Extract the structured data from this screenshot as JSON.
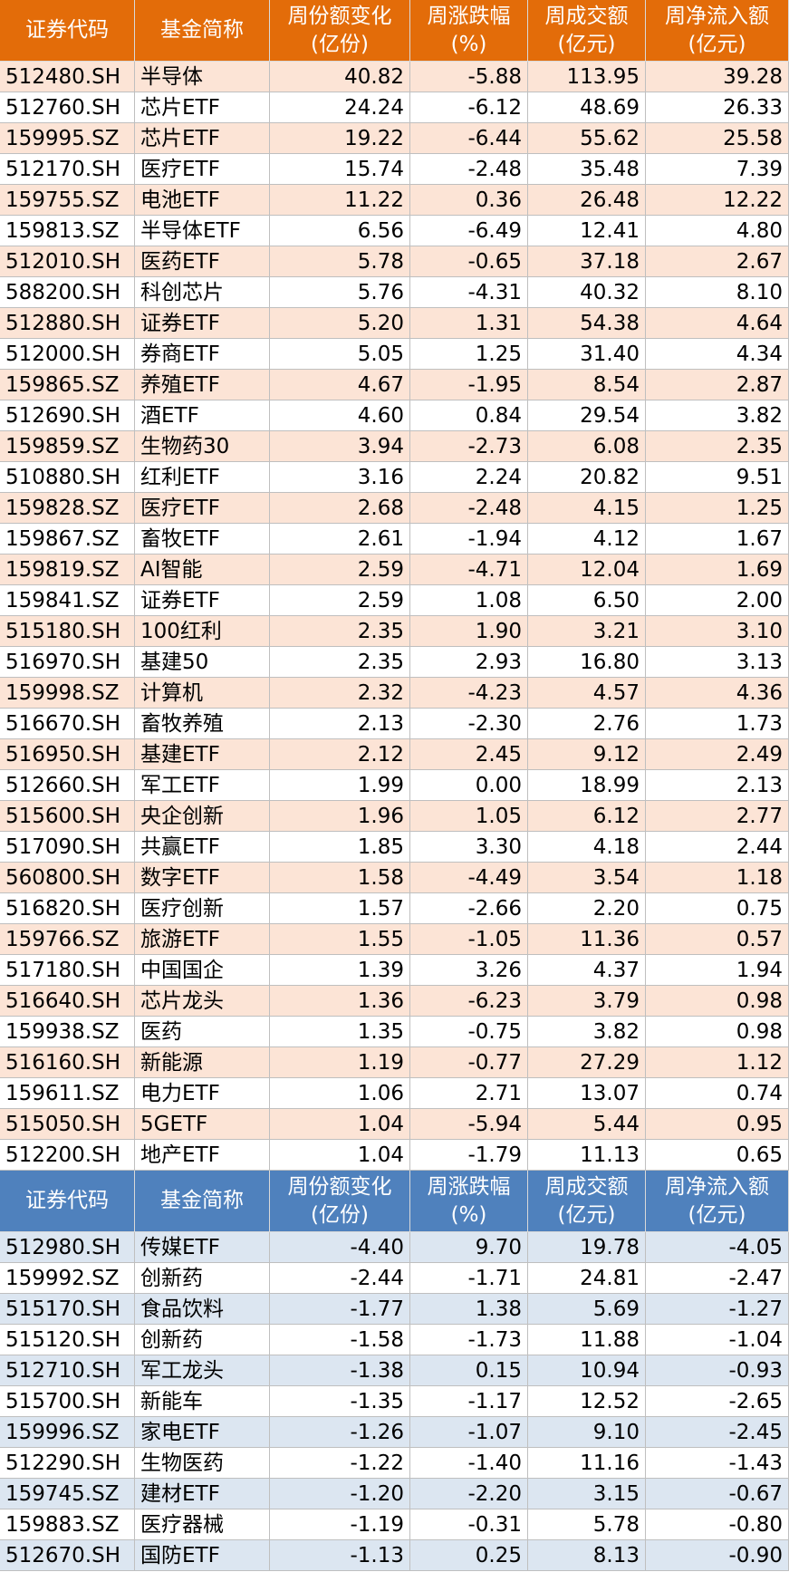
{
  "colors": {
    "inflow_header": "#e36c09",
    "inflow_stripe": "#fce4d6",
    "outflow_header": "#4f81bd",
    "outflow_stripe": "#dce6f1"
  },
  "headers": [
    [
      "证券代码"
    ],
    [
      "基金简称"
    ],
    [
      "周份额变化",
      "(亿份)"
    ],
    [
      "周涨跌幅",
      "(%)"
    ],
    [
      "周成交额",
      "(亿元)"
    ],
    [
      "周净流入额",
      "(亿元)"
    ]
  ],
  "inflow_rows": [
    [
      "512480.SH",
      "半导体",
      "40.82",
      "-5.88",
      "113.95",
      "39.28"
    ],
    [
      "512760.SH",
      "芯片ETF",
      "24.24",
      "-6.12",
      "48.69",
      "26.33"
    ],
    [
      "159995.SZ",
      "芯片ETF",
      "19.22",
      "-6.44",
      "55.62",
      "25.58"
    ],
    [
      "512170.SH",
      "医疗ETF",
      "15.74",
      "-2.48",
      "35.48",
      "7.39"
    ],
    [
      "159755.SZ",
      "电池ETF",
      "11.22",
      "0.36",
      "26.48",
      "12.22"
    ],
    [
      "159813.SZ",
      "半导体ETF",
      "6.56",
      "-6.49",
      "12.41",
      "4.80"
    ],
    [
      "512010.SH",
      "医药ETF",
      "5.78",
      "-0.65",
      "37.18",
      "2.67"
    ],
    [
      "588200.SH",
      "科创芯片",
      "5.76",
      "-4.31",
      "40.32",
      "8.10"
    ],
    [
      "512880.SH",
      "证券ETF",
      "5.20",
      "1.31",
      "54.38",
      "4.64"
    ],
    [
      "512000.SH",
      "券商ETF",
      "5.05",
      "1.25",
      "31.40",
      "4.34"
    ],
    [
      "159865.SZ",
      "养殖ETF",
      "4.67",
      "-1.95",
      "8.54",
      "2.87"
    ],
    [
      "512690.SH",
      "酒ETF",
      "4.60",
      "0.84",
      "29.54",
      "3.82"
    ],
    [
      "159859.SZ",
      "生物药30",
      "3.94",
      "-2.73",
      "6.08",
      "2.35"
    ],
    [
      "510880.SH",
      "红利ETF",
      "3.16",
      "2.24",
      "20.82",
      "9.51"
    ],
    [
      "159828.SZ",
      "医疗ETF",
      "2.68",
      "-2.48",
      "4.15",
      "1.25"
    ],
    [
      "159867.SZ",
      "畜牧ETF",
      "2.61",
      "-1.94",
      "4.12",
      "1.67"
    ],
    [
      "159819.SZ",
      "AI智能",
      "2.59",
      "-4.71",
      "12.04",
      "1.69"
    ],
    [
      "159841.SZ",
      "证券ETF",
      "2.59",
      "1.08",
      "6.50",
      "2.00"
    ],
    [
      "515180.SH",
      "100红利",
      "2.35",
      "1.90",
      "3.21",
      "3.10"
    ],
    [
      "516970.SH",
      "基建50",
      "2.35",
      "2.93",
      "16.80",
      "3.13"
    ],
    [
      "159998.SZ",
      "计算机",
      "2.32",
      "-4.23",
      "4.57",
      "4.36"
    ],
    [
      "516670.SH",
      "畜牧养殖",
      "2.13",
      "-2.30",
      "2.76",
      "1.73"
    ],
    [
      "516950.SH",
      "基建ETF",
      "2.12",
      "2.45",
      "9.12",
      "2.49"
    ],
    [
      "512660.SH",
      "军工ETF",
      "1.99",
      "0.00",
      "18.99",
      "2.13"
    ],
    [
      "515600.SH",
      "央企创新",
      "1.96",
      "1.05",
      "6.12",
      "2.77"
    ],
    [
      "517090.SH",
      "共赢ETF",
      "1.85",
      "3.30",
      "4.18",
      "2.44"
    ],
    [
      "560800.SH",
      "数字ETF",
      "1.58",
      "-4.49",
      "3.54",
      "1.18"
    ],
    [
      "516820.SH",
      "医疗创新",
      "1.57",
      "-2.66",
      "2.20",
      "0.75"
    ],
    [
      "159766.SZ",
      "旅游ETF",
      "1.55",
      "-1.05",
      "11.36",
      "0.57"
    ],
    [
      "517180.SH",
      "中国国企",
      "1.39",
      "3.26",
      "4.37",
      "1.94"
    ],
    [
      "516640.SH",
      "芯片龙头",
      "1.36",
      "-6.23",
      "3.79",
      "0.98"
    ],
    [
      "159938.SZ",
      "医药",
      "1.35",
      "-0.75",
      "3.82",
      "0.98"
    ],
    [
      "516160.SH",
      "新能源",
      "1.19",
      "-0.77",
      "27.29",
      "1.12"
    ],
    [
      "159611.SZ",
      "电力ETF",
      "1.06",
      "2.71",
      "13.07",
      "0.74"
    ],
    [
      "515050.SH",
      "5GETF",
      "1.04",
      "-5.94",
      "5.44",
      "0.95"
    ],
    [
      "512200.SH",
      "地产ETF",
      "1.04",
      "-1.79",
      "11.13",
      "0.65"
    ]
  ],
  "outflow_rows": [
    [
      "512980.SH",
      "传媒ETF",
      "-4.40",
      "9.70",
      "19.78",
      "-4.05"
    ],
    [
      "159992.SZ",
      "创新药",
      "-2.44",
      "-1.71",
      "24.81",
      "-2.47"
    ],
    [
      "515170.SH",
      "食品饮料",
      "-1.77",
      "1.38",
      "5.69",
      "-1.27"
    ],
    [
      "515120.SH",
      "创新药",
      "-1.58",
      "-1.73",
      "11.88",
      "-1.04"
    ],
    [
      "512710.SH",
      "军工龙头",
      "-1.38",
      "0.15",
      "10.94",
      "-0.93"
    ],
    [
      "515700.SH",
      "新能车",
      "-1.35",
      "-1.17",
      "12.52",
      "-2.65"
    ],
    [
      "159996.SZ",
      "家电ETF",
      "-1.26",
      "-1.07",
      "9.10",
      "-2.45"
    ],
    [
      "512290.SH",
      "生物医药",
      "-1.22",
      "-1.40",
      "11.16",
      "-1.43"
    ],
    [
      "159745.SZ",
      "建材ETF",
      "-1.20",
      "-2.20",
      "3.15",
      "-0.67"
    ],
    [
      "159883.SZ",
      "医疗器械",
      "-1.19",
      "-0.31",
      "5.78",
      "-0.80"
    ],
    [
      "512670.SH",
      "国防ETF",
      "-1.13",
      "0.25",
      "8.13",
      "-0.90"
    ]
  ]
}
